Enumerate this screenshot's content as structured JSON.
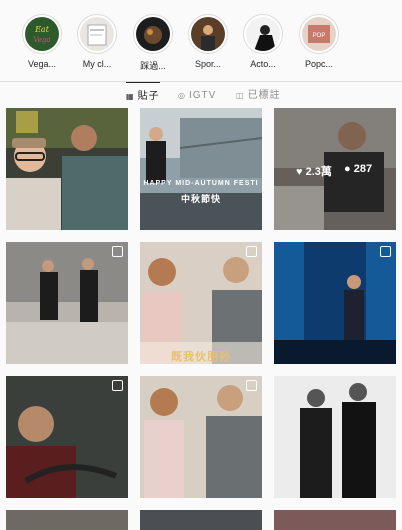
{
  "highlights": [
    {
      "label": "Vega...",
      "icon": "highlight-thumbnail"
    },
    {
      "label": "My cl...",
      "icon": "highlight-thumbnail"
    },
    {
      "label": "踩過...",
      "icon": "highlight-thumbnail"
    },
    {
      "label": "Spor...",
      "icon": "highlight-thumbnail"
    },
    {
      "label": "Acto...",
      "icon": "highlight-thumbnail"
    },
    {
      "label": "Popc...",
      "icon": "highlight-thumbnail"
    }
  ],
  "tabs": [
    {
      "label": "貼子",
      "icon": "grid-icon",
      "active": true
    },
    {
      "label": "IGTV",
      "icon": "igtv-icon",
      "active": false
    },
    {
      "label": "已標註",
      "icon": "tagged-icon",
      "active": false
    }
  ],
  "posts": {
    "p2_caption": "HAPPY MID-AUTUMN FESTI",
    "p2_caption2": "中秋節快",
    "p3_likes": "2.3萬",
    "p3_comments": "287",
    "p5_caption": "既我伙朋孙"
  },
  "colors": {
    "accent": "#262626",
    "muted": "#8e8e8e",
    "border": "#dbdbdb",
    "background": "#fafafa"
  }
}
